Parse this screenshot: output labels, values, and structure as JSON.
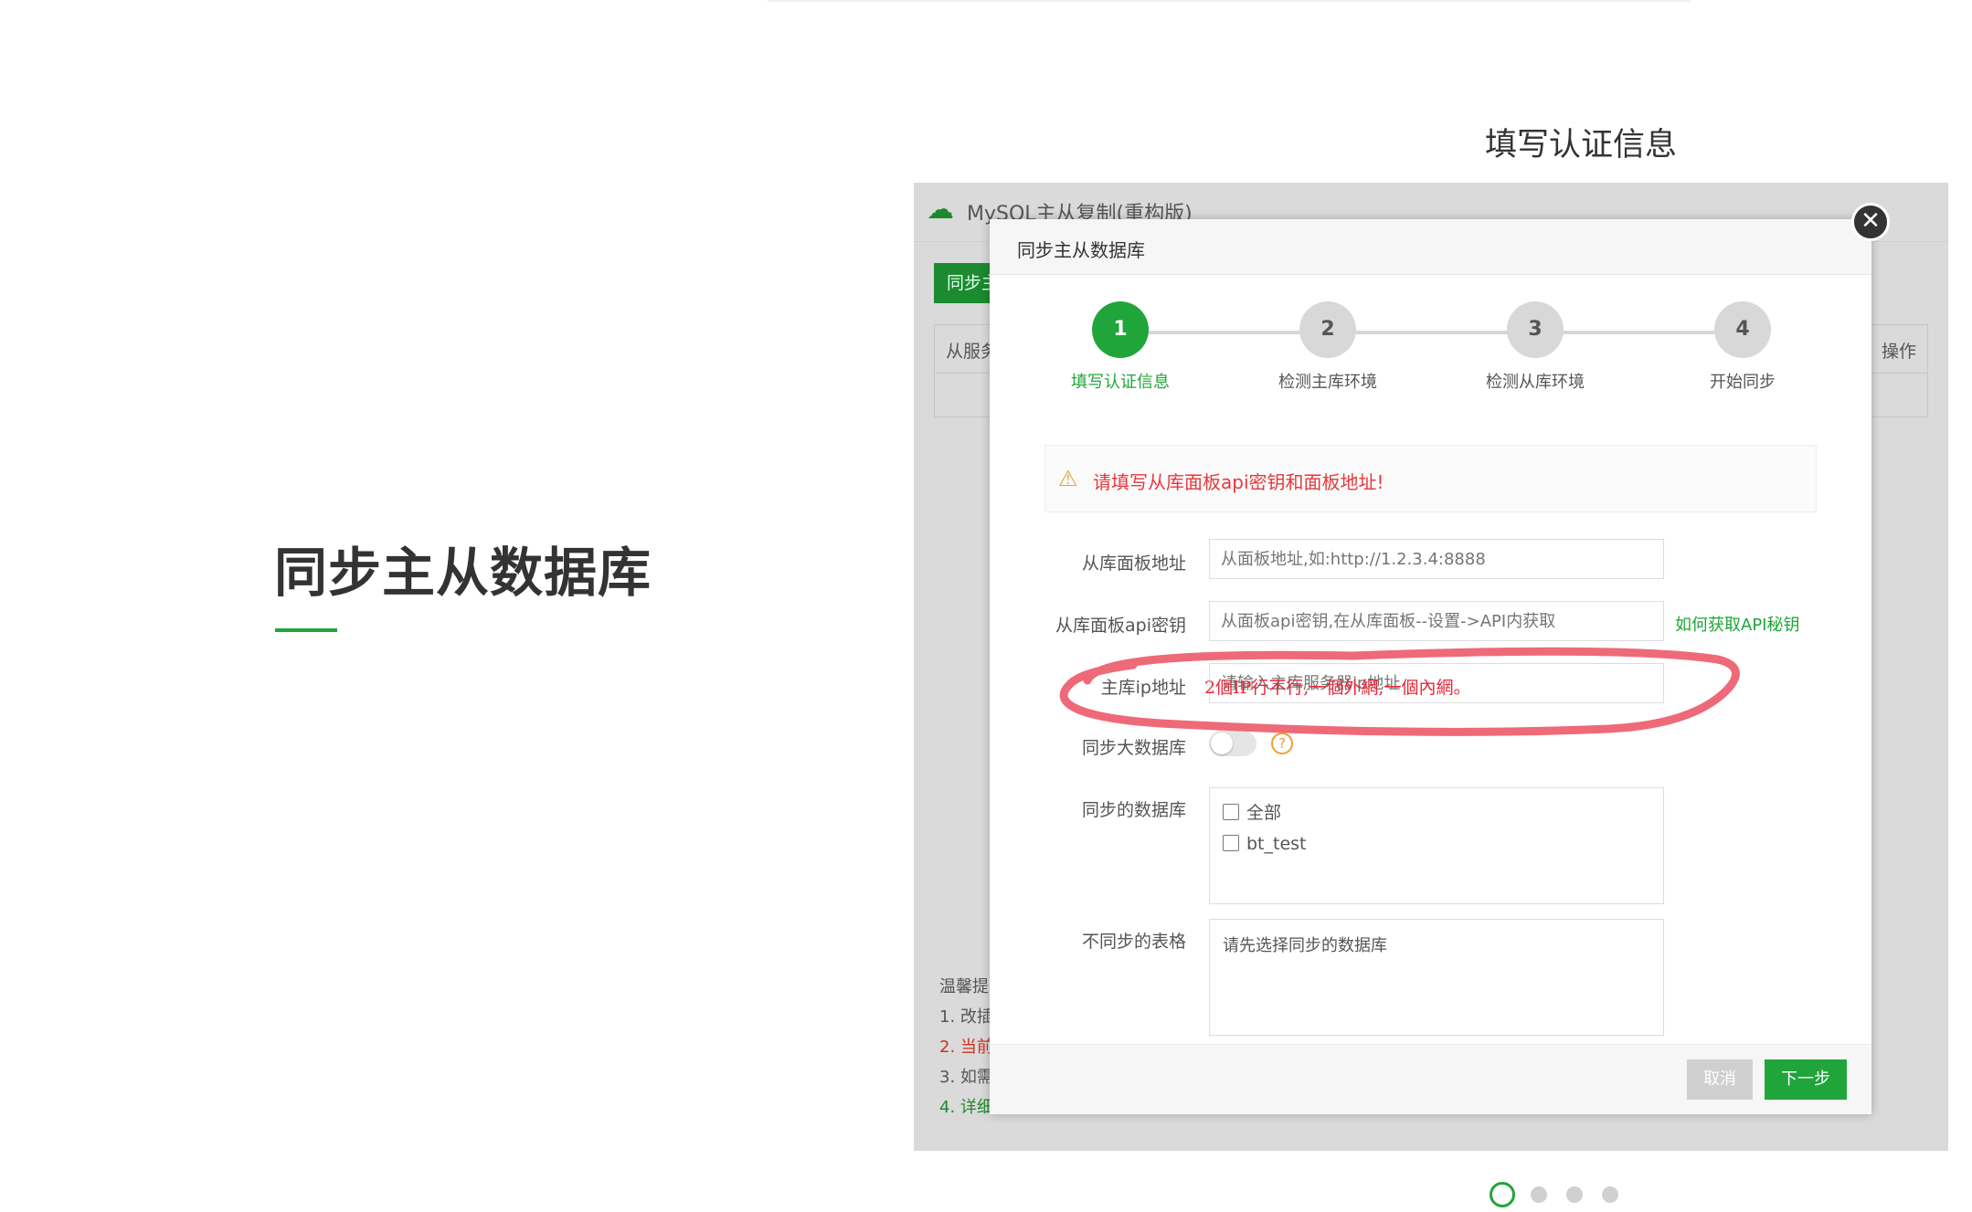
{
  "left_panel": {
    "title": "同步主从数据库"
  },
  "slide_caption": "填写认证信息",
  "background_app": {
    "title": "MySQL主从复制(重构版)",
    "sync_button": "同步主",
    "table_header_left": "从服务",
    "table_header_right": "操作",
    "tips": [
      "温馨提",
      "1. 改插",
      "2. 当前",
      "3. 如需",
      "4. 详细"
    ]
  },
  "modal": {
    "title": "同步主从数据库",
    "close_symbol": "✕",
    "steps": [
      {
        "number": "1",
        "label": "填写认证信息",
        "active": true
      },
      {
        "number": "2",
        "label": "检测主库环境",
        "active": false
      },
      {
        "number": "3",
        "label": "检测从库环境",
        "active": false
      },
      {
        "number": "4",
        "label": "开始同步",
        "active": false
      }
    ],
    "warning": "请填写从库面板api密钥和面板地址!",
    "fields": {
      "panel_url": {
        "label": "从库面板地址",
        "placeholder": "从面板地址,如:http://1.2.3.4:8888"
      },
      "api_key": {
        "label": "从库面板api密钥",
        "placeholder": "从面板api密钥,在从库面板--设置->API内获取",
        "help_link": "如何获取API秘钥"
      },
      "master_ip": {
        "label": "主库ip地址",
        "placeholder": "请输入主库服务器ip地址"
      },
      "sync_large_db": {
        "label": "同步大数据库",
        "enabled": false,
        "help_icon": "?"
      },
      "sync_databases": {
        "label": "同步的数据库",
        "options": [
          "全部",
          "bt_test"
        ]
      },
      "exclude_tables": {
        "label": "不同步的表格",
        "placeholder": "请先选择同步的数据库"
      }
    },
    "buttons": {
      "cancel": "取消",
      "next": "下一步"
    }
  },
  "annotation": {
    "text": "2個IP行不行,一個外網,一個內網。",
    "color": "#e8273a"
  },
  "carousel": {
    "total": 4,
    "active_index": 0
  },
  "colors": {
    "brand_green": "#20a53a",
    "warning_red": "#e4393c",
    "annotation_red": "#e8273a"
  }
}
